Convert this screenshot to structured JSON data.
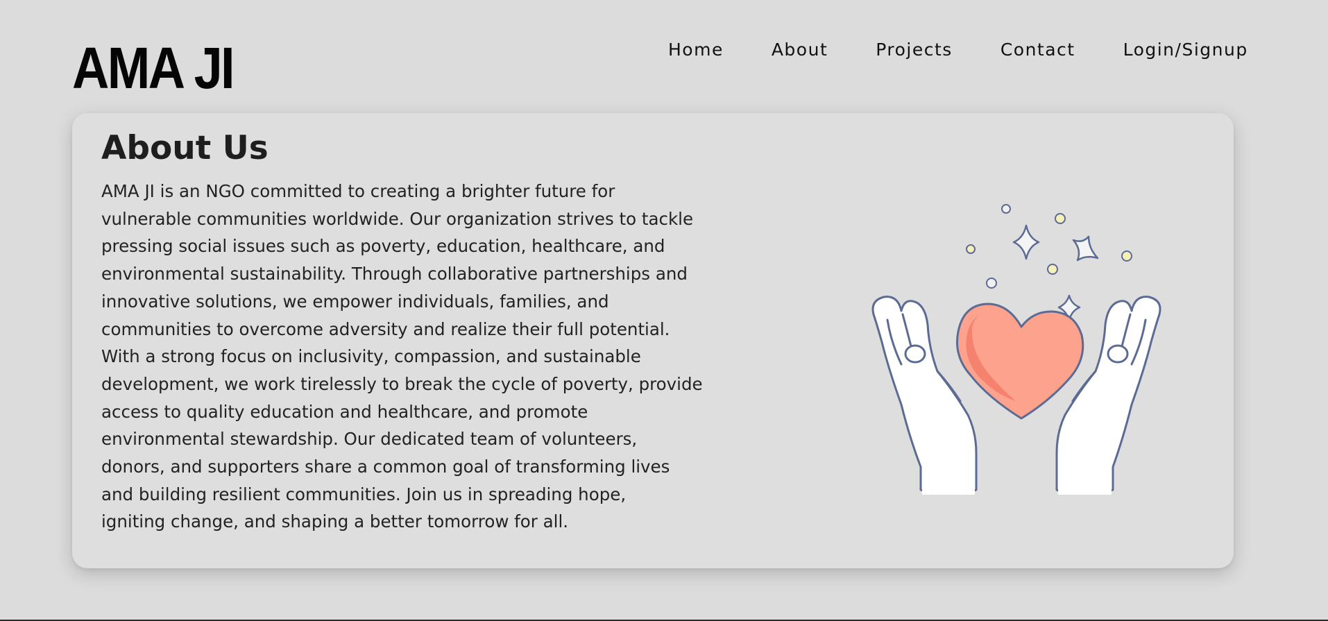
{
  "brand": {
    "logo": "AMA JI"
  },
  "nav": {
    "items": [
      {
        "label": "Home"
      },
      {
        "label": "About"
      },
      {
        "label": "Projects"
      },
      {
        "label": "Contact"
      },
      {
        "label": "Login/Signup"
      }
    ]
  },
  "about": {
    "title": "About Us",
    "lines": [
      "AMA JI is an NGO committed to creating a brighter future for",
      "vulnerable communities worldwide. Our organization strives to tackle",
      "pressing social issues such as poverty, education, healthcare, and",
      "environmental sustainability. Through collaborative partnerships and",
      "innovative solutions, we empower individuals, families, and",
      "communities to overcome adversity and realize their full potential.",
      "With a strong focus on inclusivity, compassion, and sustainable",
      "development, we work tirelessly to break the cycle of poverty, provide",
      "access to quality education and healthcare, and promote",
      "environmental stewardship. Our dedicated team of volunteers,",
      "donors, and supporters share a common goal of transforming lives",
      "and building resilient communities. Join us in spreading hope,",
      "igniting change, and shaping a better tomorrow for all."
    ],
    "illustration_icon": "hands-holding-heart-icon"
  },
  "colors": {
    "page_background": "#dcdcdc",
    "card_background": "#dedede",
    "heart": "#fda28c",
    "heart_shadow": "#f5826e",
    "outline": "#5b6b94",
    "dot_yellow": "#f4f0b8"
  }
}
